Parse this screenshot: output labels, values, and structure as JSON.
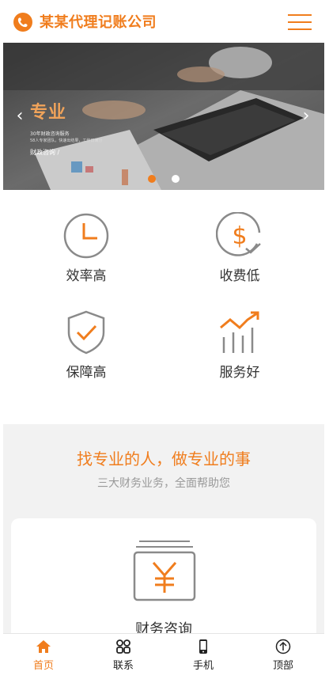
{
  "header": {
    "site_title": "某某代理记账公司",
    "logo_icon": "phone-leaf-logo-icon",
    "menu_icon": "hamburger-menu-icon"
  },
  "banner": {
    "title": "专业",
    "line1": "30年财政咨询服务",
    "line2": "58人专家团队，快速出结果，工作日满分",
    "line3": "财政咨询 /",
    "prev_icon": "chevron-left-icon",
    "next_icon": "chevron-right-icon",
    "slide_count": 2,
    "active_slide": 1
  },
  "features": [
    {
      "label": "效率高",
      "icon": "clock-icon"
    },
    {
      "label": "收费低",
      "icon": "dollar-check-icon"
    },
    {
      "label": "保障高",
      "icon": "shield-check-icon"
    },
    {
      "label": "服务好",
      "icon": "growth-chart-icon"
    }
  ],
  "section": {
    "title": "找专业的人，做专业的事",
    "subtitle": "三大财务业务，全面帮助您"
  },
  "card": {
    "title": "财务咨询",
    "icon": "yen-document-icon"
  },
  "bottom_nav": [
    {
      "label": "首页",
      "icon": "home-icon",
      "active": true
    },
    {
      "label": "联系",
      "icon": "grid-icon",
      "active": false
    },
    {
      "label": "手机",
      "icon": "mobile-icon",
      "active": false
    },
    {
      "label": "顶部",
      "icon": "arrow-up-circle-icon",
      "active": false
    }
  ],
  "colors": {
    "accent": "#f07d1d",
    "section_bg": "#f2f2f2",
    "icon_gray": "#8a8a8a"
  }
}
